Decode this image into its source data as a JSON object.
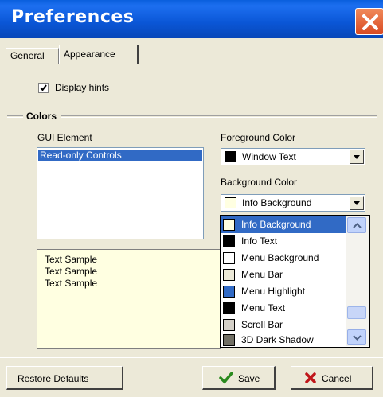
{
  "window": {
    "title": "Preferences"
  },
  "tabs": [
    {
      "label": "General",
      "active": false
    },
    {
      "label": "Appearance",
      "active": true
    }
  ],
  "display_hints": {
    "label": "Display hints",
    "checked": true
  },
  "colors_group": {
    "title": "Colors",
    "gui_element_label": "GUI Element",
    "gui_elements": [
      "Read-only Controls"
    ],
    "selected_gui_element": "Read-only Controls",
    "foreground_label": "Foreground Color",
    "foreground_value": "Window Text",
    "foreground_swatch": "#000000",
    "background_label": "Background Color",
    "background_value": "Info Background",
    "background_swatch": "#ffffe1"
  },
  "sample": {
    "lines": [
      "Text Sample",
      "Text Sample",
      "Text Sample"
    ]
  },
  "dropdown": {
    "options": [
      {
        "label": "Info Background",
        "color": "#ffffe1",
        "highlighted": true
      },
      {
        "label": "Info Text",
        "color": "#000000",
        "highlighted": false
      },
      {
        "label": "Menu Background",
        "color": "#ffffff",
        "highlighted": false
      },
      {
        "label": "Menu Bar",
        "color": "#ece9d8",
        "highlighted": false
      },
      {
        "label": "Menu Highlight",
        "color": "#316ac5",
        "highlighted": false
      },
      {
        "label": "Menu Text",
        "color": "#000000",
        "highlighted": false
      },
      {
        "label": "Scroll Bar",
        "color": "#d4d0c8",
        "highlighted": false
      },
      {
        "label": "3D Dark Shadow",
        "color": "#716f64",
        "highlighted": false
      }
    ]
  },
  "buttons": {
    "restore": "Restore Defaults",
    "save": "Save",
    "cancel": "Cancel"
  },
  "colors": {
    "selection": "#316ac5",
    "title_bar": "#0a56d6",
    "dialog": "#ece9d8"
  },
  "icons": {
    "close": "close-icon",
    "save": "checkmark-icon",
    "cancel": "x-icon"
  }
}
